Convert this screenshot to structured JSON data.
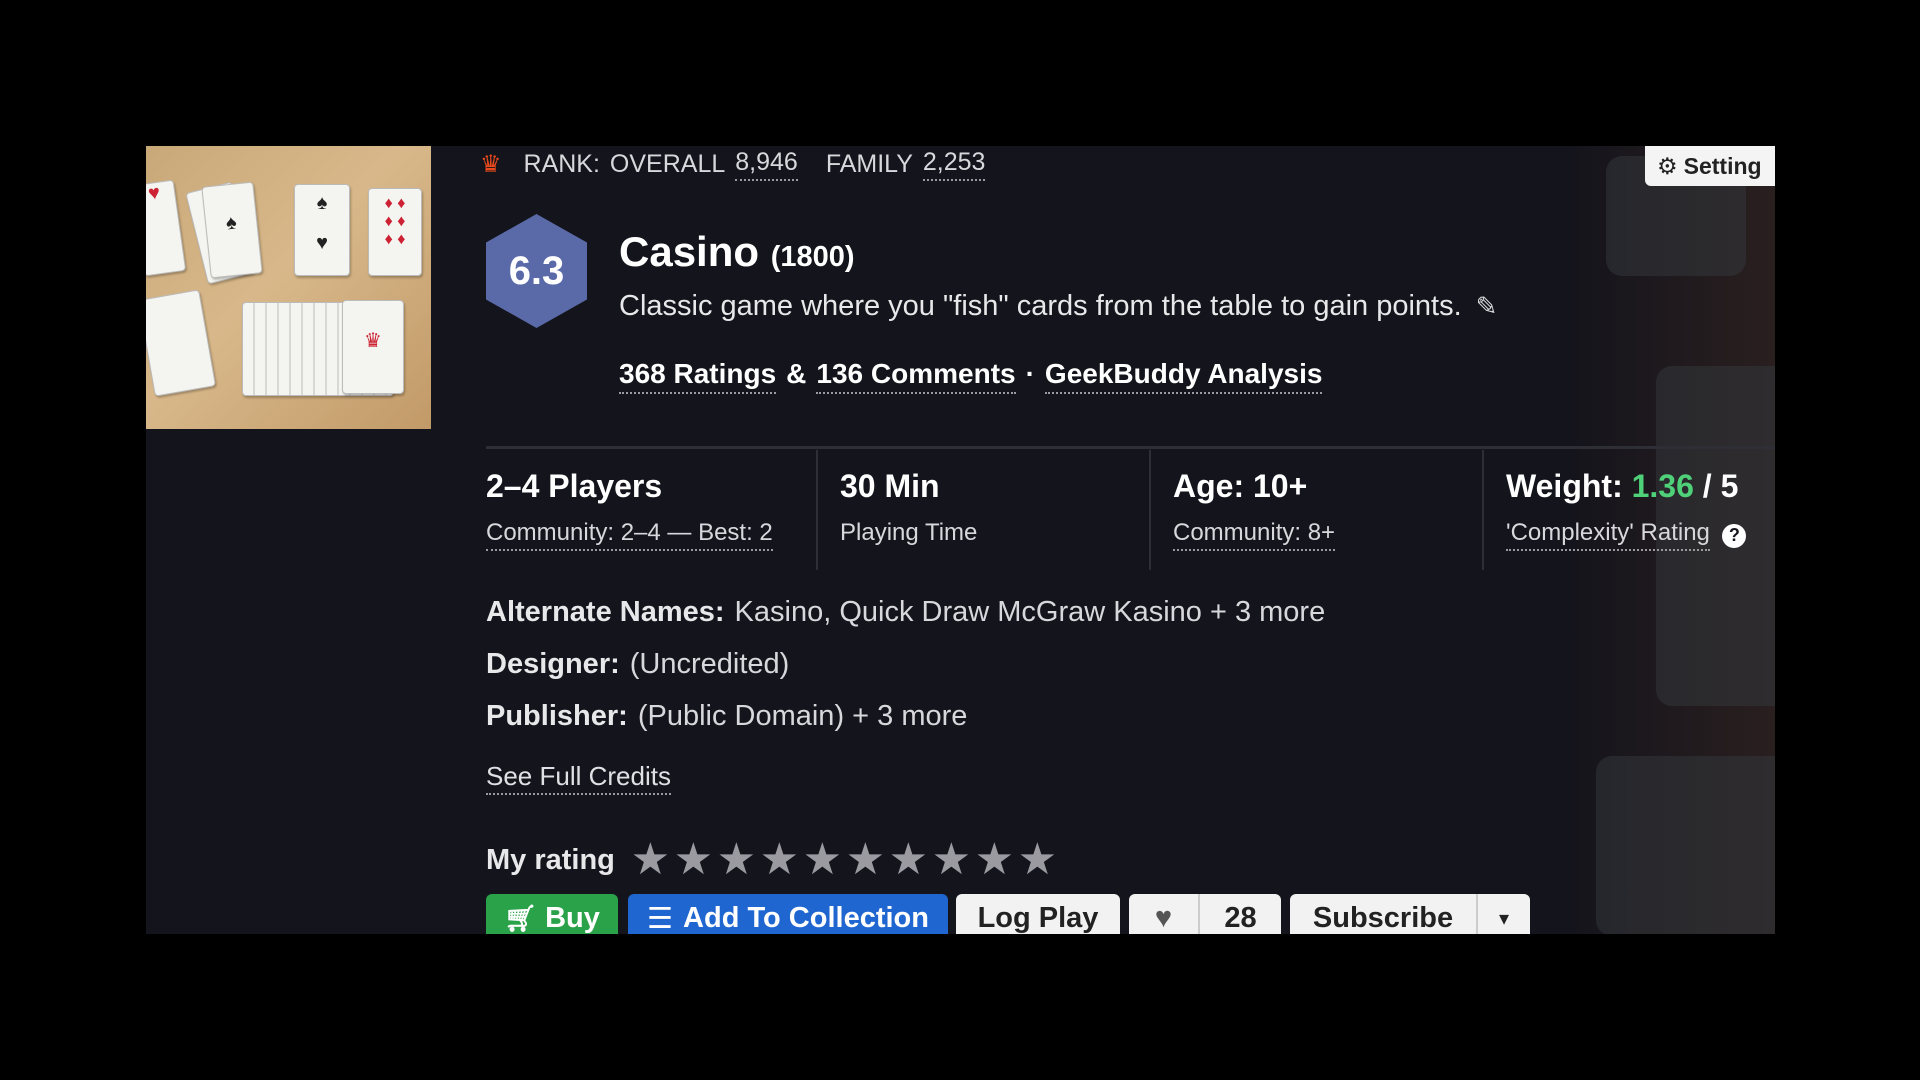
{
  "rank": {
    "prefix": "RANK:",
    "overall_label": "OVERALL",
    "overall_value": "8,946",
    "family_label": "FAMILY",
    "family_value": "2,253"
  },
  "settings_label": "Setting",
  "game": {
    "rating": "6.3",
    "title": "Casino",
    "year": "(1800)",
    "description": "Classic game where you \"fish\" cards from the table to gain points.",
    "ratings_link": "368 Ratings",
    "amp": "&",
    "comments_link": "136 Comments",
    "sep": "·",
    "geekbuddy_link": "GeekBuddy Analysis"
  },
  "stats": {
    "players": {
      "big": "2–4 Players",
      "small": "Community: 2–4 — Best: 2"
    },
    "time": {
      "big": "30 Min",
      "small": "Playing Time"
    },
    "age": {
      "big": "Age: 10+",
      "small": "Community: 8+"
    },
    "weight": {
      "label": "Weight:",
      "value": "1.36",
      "suffix": "/ 5",
      "small": "'Complexity' Rating"
    }
  },
  "meta": {
    "alt_label": "Alternate Names:",
    "alt_value": "Kasino, Quick Draw McGraw Kasino + 3 more",
    "designer_label": "Designer:",
    "designer_value": "(Uncredited)",
    "publisher_label": "Publisher:",
    "publisher_value": "(Public Domain) + 3 more",
    "credits_link": "See Full Credits"
  },
  "my_rating": {
    "label": "My rating",
    "stars_max": 10,
    "stars_filled": 0
  },
  "actions": {
    "buy": "Buy",
    "add": "Add To Collection",
    "log": "Log Play",
    "likes": "28",
    "subscribe": "Subscribe"
  },
  "colors": {
    "buy": "#2aa24a",
    "add": "#1f66d1",
    "hex": "#5a6aa8",
    "weight": "#4fd179",
    "crown": "#e84a1c"
  },
  "icons": [
    "crown-icon",
    "gear-icon",
    "pencil-icon",
    "help-icon",
    "star-icon",
    "cart-icon",
    "list-icon",
    "heart-icon",
    "caret-down-icon"
  ]
}
